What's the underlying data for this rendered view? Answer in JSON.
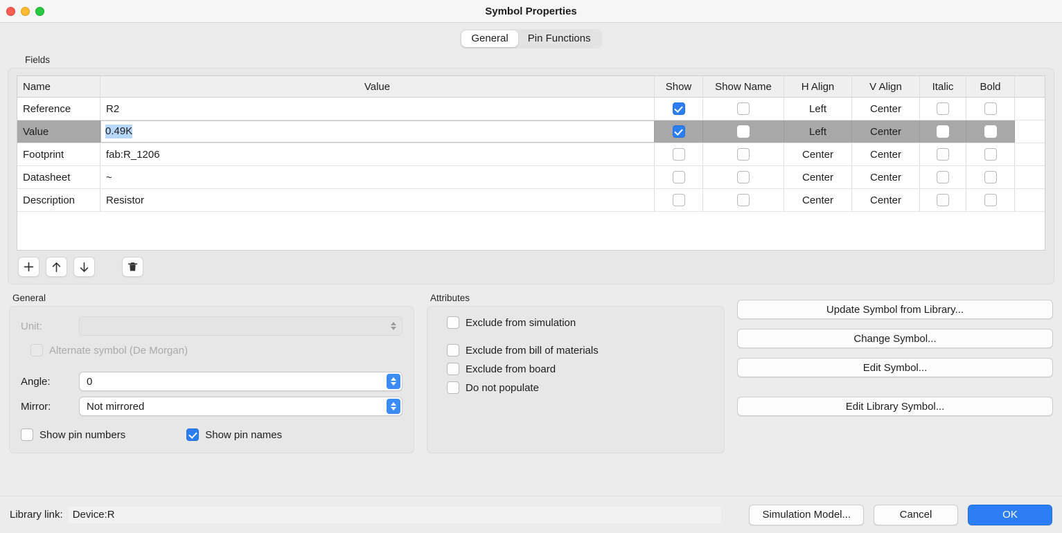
{
  "window": {
    "title": "Symbol Properties",
    "traffic_lights": [
      "close-button",
      "minimize-button",
      "zoom-button"
    ]
  },
  "tabs": [
    {
      "label": "General",
      "active": true
    },
    {
      "label": "Pin Functions",
      "active": false
    }
  ],
  "fields": {
    "group_label": "Fields",
    "columns": [
      "Name",
      "Value",
      "Show",
      "Show Name",
      "H Align",
      "V Align",
      "Italic",
      "Bold"
    ],
    "rows": [
      {
        "name": "Reference",
        "value": "R2",
        "show": true,
        "show_name": false,
        "h_align": "Left",
        "v_align": "Center",
        "italic": false,
        "bold": false,
        "selected": false,
        "editing": false
      },
      {
        "name": "Value",
        "value": "0.49K",
        "show": true,
        "show_name": false,
        "h_align": "Left",
        "v_align": "Center",
        "italic": false,
        "bold": false,
        "selected": true,
        "editing": true
      },
      {
        "name": "Footprint",
        "value": "fab:R_1206",
        "show": false,
        "show_name": false,
        "h_align": "Center",
        "v_align": "Center",
        "italic": false,
        "bold": false,
        "selected": false,
        "editing": false
      },
      {
        "name": "Datasheet",
        "value": "~",
        "show": false,
        "show_name": false,
        "h_align": "Center",
        "v_align": "Center",
        "italic": false,
        "bold": false,
        "selected": false,
        "editing": false
      },
      {
        "name": "Description",
        "value": "Resistor",
        "show": false,
        "show_name": false,
        "h_align": "Center",
        "v_align": "Center",
        "italic": false,
        "bold": false,
        "selected": false,
        "editing": false
      }
    ],
    "toolbar": [
      {
        "icon": "plus-icon",
        "name": "add-field-button"
      },
      {
        "icon": "arrow-up-icon",
        "name": "move-field-up-button"
      },
      {
        "icon": "arrow-down-icon",
        "name": "move-field-down-button"
      },
      {
        "icon": "trash-icon",
        "name": "delete-field-button"
      }
    ]
  },
  "general": {
    "label": "General",
    "unit_label": "Unit:",
    "unit_value": "",
    "unit_disabled": true,
    "alternate_symbol_label": "Alternate symbol (De Morgan)",
    "alternate_symbol_checked": false,
    "alternate_symbol_disabled": true,
    "angle_label": "Angle:",
    "angle_value": "0",
    "mirror_label": "Mirror:",
    "mirror_value": "Not mirrored",
    "show_pin_numbers_label": "Show pin numbers",
    "show_pin_numbers_checked": false,
    "show_pin_names_label": "Show pin names",
    "show_pin_names_checked": true
  },
  "attributes": {
    "label": "Attributes",
    "items": [
      {
        "label": "Exclude from simulation",
        "checked": false
      },
      {
        "label": "Exclude from bill of materials",
        "checked": false
      },
      {
        "label": "Exclude from board",
        "checked": false
      },
      {
        "label": "Do not populate",
        "checked": false
      }
    ]
  },
  "symbol_actions": [
    {
      "label": "Update Symbol from Library...",
      "name": "update-symbol-from-library-button"
    },
    {
      "label": "Change Symbol...",
      "name": "change-symbol-button"
    },
    {
      "label": "Edit Symbol...",
      "name": "edit-symbol-button"
    },
    {
      "label": "Edit Library Symbol...",
      "name": "edit-library-symbol-button"
    }
  ],
  "footer": {
    "library_link_label": "Library link:",
    "library_link_value": "Device:R",
    "simulation_model_label": "Simulation Model...",
    "cancel_label": "Cancel",
    "ok_label": "OK"
  },
  "colors": {
    "accent": "#2b7ef3",
    "selection_row": "#a8a8a8",
    "text_selection": "#b7d8fa",
    "window_bg": "#ececec"
  }
}
